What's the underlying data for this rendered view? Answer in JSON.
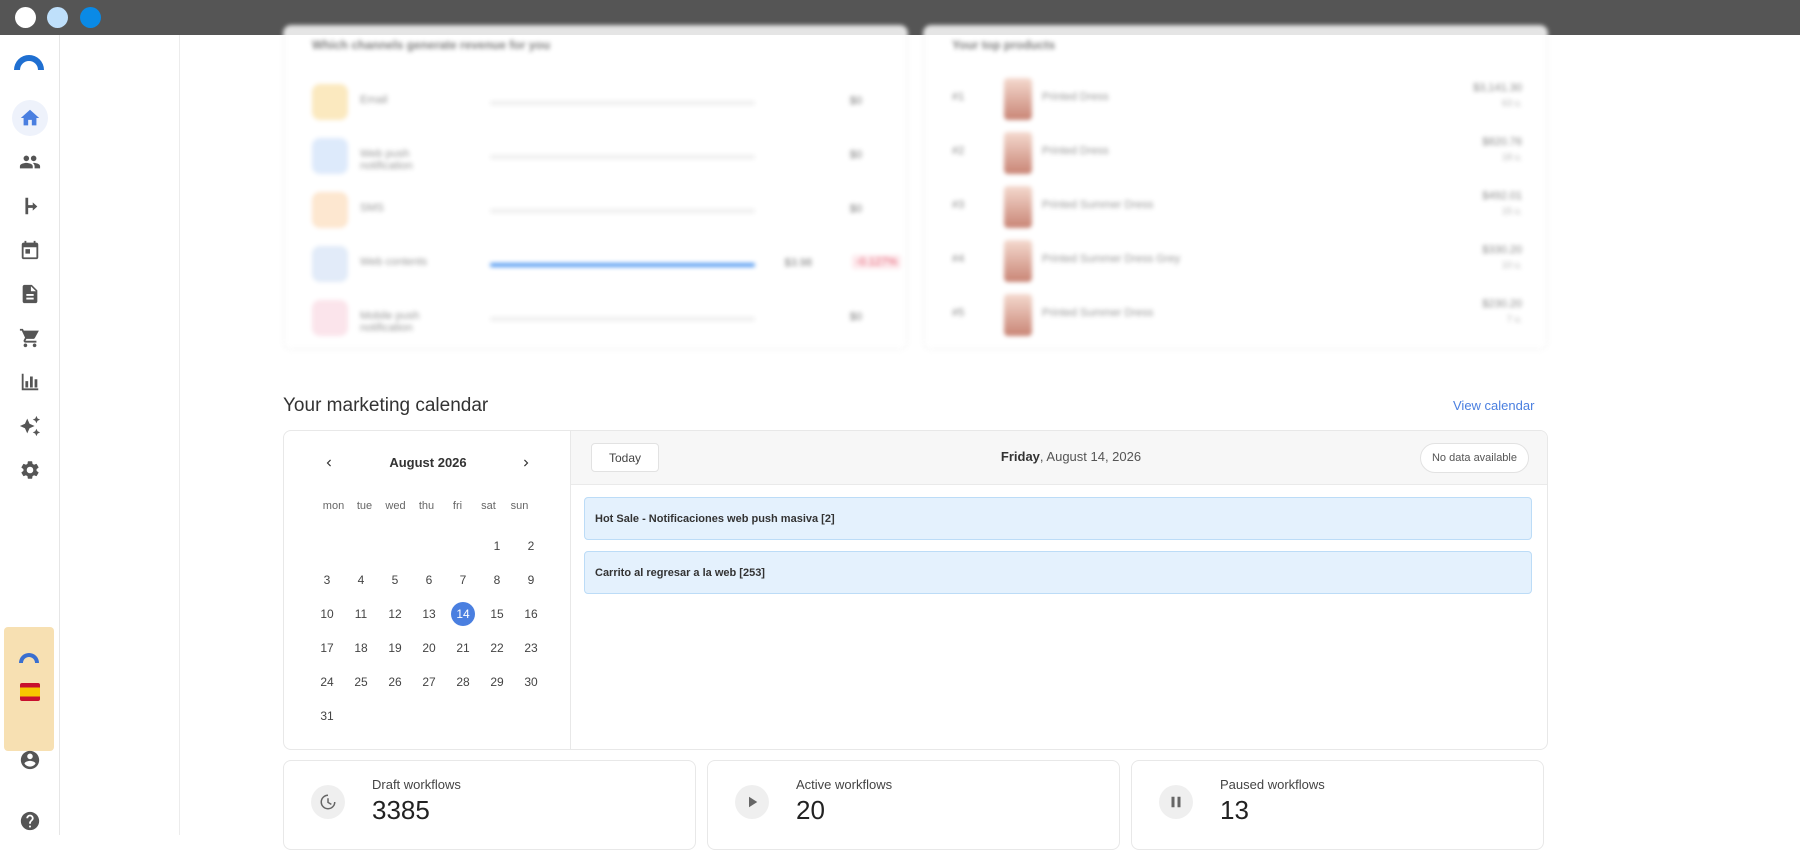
{
  "window": {
    "controls": [
      "close",
      "minimize",
      "maximize"
    ]
  },
  "rail": {
    "items": [
      {
        "name": "home",
        "icon": "home-icon",
        "active": true
      },
      {
        "name": "contacts",
        "icon": "people-icon"
      },
      {
        "name": "automations",
        "icon": "branch-icon"
      },
      {
        "name": "calendar",
        "icon": "calendar-icon"
      },
      {
        "name": "templates",
        "icon": "document-icon"
      },
      {
        "name": "ecommerce",
        "icon": "cart-icon"
      },
      {
        "name": "reports",
        "icon": "bar-chart-icon"
      },
      {
        "name": "ai",
        "icon": "sparkle-icon"
      },
      {
        "name": "settings",
        "icon": "gear-icon"
      }
    ],
    "bottom": [
      {
        "name": "account",
        "icon": "account-circle-icon"
      },
      {
        "name": "help",
        "icon": "help-icon"
      }
    ],
    "accent": "#4a7fe0"
  },
  "channels": {
    "title": "Which channels generate revenue for you",
    "rows": [
      {
        "label": "Email",
        "value": "$0",
        "color": "#fbe6b5",
        "fill": 0
      },
      {
        "label": "Web push notification",
        "value": "$0",
        "color": "#d8e7fb",
        "fill": 0
      },
      {
        "label": "SMS",
        "value": "$0",
        "color": "#fde3c8",
        "fill": 0
      },
      {
        "label": "Web contents",
        "value": "$3.98",
        "badge": "-0.127%",
        "color": "#dde8f8",
        "fill": 1
      },
      {
        "label": "Mobile push notification",
        "value": "$0",
        "color": "#fbe0e8",
        "fill": 0
      }
    ]
  },
  "products": {
    "title": "Your top products",
    "rows": [
      {
        "rank": "#1",
        "name": "Printed Dress",
        "price": "$3,141.30",
        "sub": "63 u."
      },
      {
        "rank": "#2",
        "name": "Printed Dress",
        "price": "$820.76",
        "sub": "18 u."
      },
      {
        "rank": "#3",
        "name": "Printed Summer Dress",
        "price": "$492.01",
        "sub": "15 u."
      },
      {
        "rank": "#4",
        "name": "Printed Summer Dress Grey",
        "price": "$330.20",
        "sub": "10 u."
      },
      {
        "rank": "#5",
        "name": "Printed Summer Dress",
        "price": "$230.20",
        "sub": "7 u."
      }
    ]
  },
  "calendar": {
    "heading": "Your marketing calendar",
    "view_link": "View calendar",
    "month_label": "August 2026",
    "weekdays": [
      "mon",
      "tue",
      "wed",
      "thu",
      "fri",
      "sat",
      "sun"
    ],
    "leading_blanks": 5,
    "days_in_month": 31,
    "selected_day": 14,
    "today_button": "Today",
    "selected_weekday": "Friday",
    "selected_date": ", August 14, 2026",
    "no_data": "No data available",
    "events": [
      "Hot Sale - Notificaciones web push masiva [2]",
      "Carrito al regresar a la web [253]"
    ]
  },
  "stats": [
    {
      "label": "Draft workflows",
      "value": "3385",
      "icon": "draft-icon"
    },
    {
      "label": "Active workflows",
      "value": "20",
      "icon": "play-icon"
    },
    {
      "label": "Paused workflows",
      "value": "13",
      "icon": "pause-icon"
    }
  ]
}
